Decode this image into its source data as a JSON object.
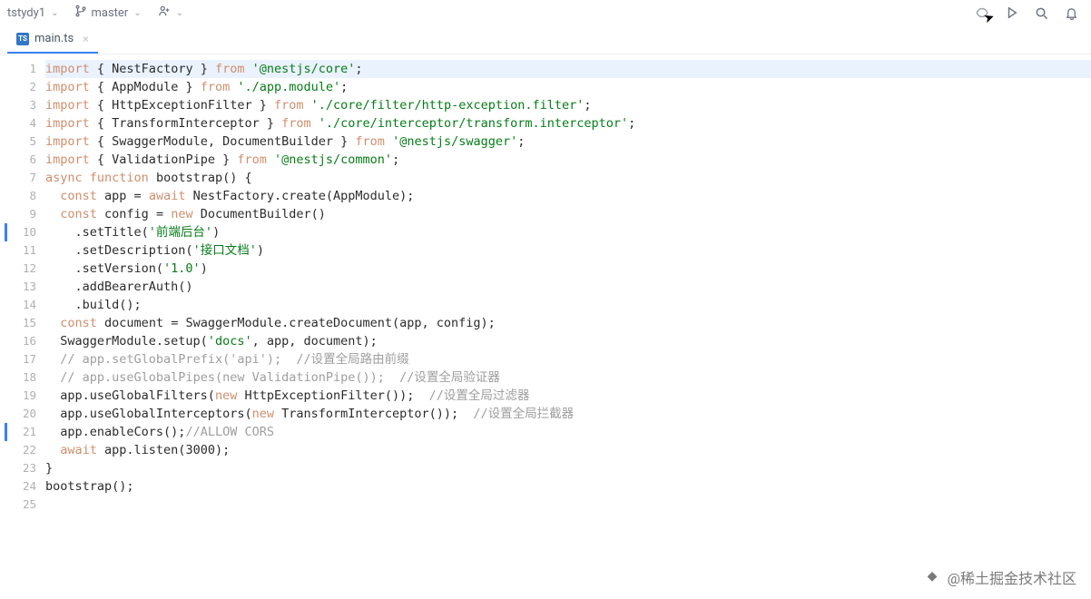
{
  "toolbar": {
    "project": "tstydy1",
    "branch": "master"
  },
  "tab": {
    "filename": "main.ts",
    "file_badge": "TS"
  },
  "code": {
    "lines": [
      {
        "n": 1,
        "hl": true,
        "tokens": [
          {
            "c": "kw-import",
            "t": "import"
          },
          {
            "c": "punct",
            "t": " { "
          },
          {
            "c": "ident",
            "t": "NestFactory"
          },
          {
            "c": "punct",
            "t": " } "
          },
          {
            "c": "kw-from",
            "t": "from"
          },
          {
            "c": "punct",
            "t": " "
          },
          {
            "c": "str",
            "t": "'@nestjs/core'"
          },
          {
            "c": "punct",
            "t": ";"
          }
        ]
      },
      {
        "n": 2,
        "tokens": [
          {
            "c": "kw-import",
            "t": "import"
          },
          {
            "c": "punct",
            "t": " { "
          },
          {
            "c": "ident",
            "t": "AppModule"
          },
          {
            "c": "punct",
            "t": " } "
          },
          {
            "c": "kw-from",
            "t": "from"
          },
          {
            "c": "punct",
            "t": " "
          },
          {
            "c": "str",
            "t": "'./app.module'"
          },
          {
            "c": "punct",
            "t": ";"
          }
        ]
      },
      {
        "n": 3,
        "tokens": [
          {
            "c": "kw-import",
            "t": "import"
          },
          {
            "c": "punct",
            "t": " { "
          },
          {
            "c": "ident",
            "t": "HttpExceptionFilter"
          },
          {
            "c": "punct",
            "t": " } "
          },
          {
            "c": "kw-from",
            "t": "from"
          },
          {
            "c": "punct",
            "t": " "
          },
          {
            "c": "str",
            "t": "'./core/filter/http-exception.filter'"
          },
          {
            "c": "punct",
            "t": ";"
          }
        ]
      },
      {
        "n": 4,
        "tokens": [
          {
            "c": "kw-import",
            "t": "import"
          },
          {
            "c": "punct",
            "t": " { "
          },
          {
            "c": "ident",
            "t": "TransformInterceptor"
          },
          {
            "c": "punct",
            "t": " } "
          },
          {
            "c": "kw-from",
            "t": "from"
          },
          {
            "c": "punct",
            "t": " "
          },
          {
            "c": "str",
            "t": "'./core/interceptor/transform.interceptor'"
          },
          {
            "c": "punct",
            "t": ";"
          }
        ]
      },
      {
        "n": 5,
        "tokens": [
          {
            "c": "kw-import",
            "t": "import"
          },
          {
            "c": "punct",
            "t": " { "
          },
          {
            "c": "ident",
            "t": "SwaggerModule, DocumentBuilder"
          },
          {
            "c": "punct",
            "t": " } "
          },
          {
            "c": "kw-from",
            "t": "from"
          },
          {
            "c": "punct",
            "t": " "
          },
          {
            "c": "str",
            "t": "'@nestjs/swagger'"
          },
          {
            "c": "punct",
            "t": ";"
          }
        ]
      },
      {
        "n": 6,
        "tokens": [
          {
            "c": "kw-import",
            "t": "import"
          },
          {
            "c": "punct",
            "t": " { "
          },
          {
            "c": "ident",
            "t": "ValidationPipe"
          },
          {
            "c": "punct",
            "t": " } "
          },
          {
            "c": "kw-from",
            "t": "from"
          },
          {
            "c": "punct",
            "t": " "
          },
          {
            "c": "str",
            "t": "'@nestjs/common'"
          },
          {
            "c": "punct",
            "t": ";"
          }
        ]
      },
      {
        "n": 7,
        "tokens": [
          {
            "c": "kw-async",
            "t": "async"
          },
          {
            "c": "punct",
            "t": " "
          },
          {
            "c": "kw-func",
            "t": "function"
          },
          {
            "c": "punct",
            "t": " "
          },
          {
            "c": "ident",
            "t": "bootstrap() {"
          }
        ]
      },
      {
        "n": 8,
        "tokens": [
          {
            "c": "punct",
            "t": "  "
          },
          {
            "c": "kw-const",
            "t": "const"
          },
          {
            "c": "punct",
            "t": " "
          },
          {
            "c": "ident",
            "t": "app = "
          },
          {
            "c": "kw-await",
            "t": "await"
          },
          {
            "c": "punct",
            "t": " "
          },
          {
            "c": "ident",
            "t": "NestFactory.create(AppModule);"
          }
        ]
      },
      {
        "n": 9,
        "tokens": [
          {
            "c": "punct",
            "t": "  "
          },
          {
            "c": "kw-const",
            "t": "const"
          },
          {
            "c": "punct",
            "t": " "
          },
          {
            "c": "ident",
            "t": "config = "
          },
          {
            "c": "kw-new",
            "t": "new"
          },
          {
            "c": "punct",
            "t": " "
          },
          {
            "c": "ident",
            "t": "DocumentBuilder()"
          }
        ]
      },
      {
        "n": 10,
        "bar": true,
        "tokens": [
          {
            "c": "ident",
            "t": "    .setTitle("
          },
          {
            "c": "str",
            "t": "'前端后台'"
          },
          {
            "c": "ident",
            "t": ")"
          }
        ]
      },
      {
        "n": 11,
        "tokens": [
          {
            "c": "ident",
            "t": "    .setDescription("
          },
          {
            "c": "str",
            "t": "'接口文档'"
          },
          {
            "c": "ident",
            "t": ")"
          }
        ]
      },
      {
        "n": 12,
        "tokens": [
          {
            "c": "ident",
            "t": "    .setVersion("
          },
          {
            "c": "str",
            "t": "'1.0'"
          },
          {
            "c": "ident",
            "t": ")"
          }
        ]
      },
      {
        "n": 13,
        "tokens": [
          {
            "c": "ident",
            "t": "    .addBearerAuth()"
          }
        ]
      },
      {
        "n": 14,
        "tokens": [
          {
            "c": "ident",
            "t": "    .build();"
          }
        ]
      },
      {
        "n": 15,
        "tokens": [
          {
            "c": "punct",
            "t": "  "
          },
          {
            "c": "kw-const",
            "t": "const"
          },
          {
            "c": "punct",
            "t": " "
          },
          {
            "c": "ident",
            "t": "document = SwaggerModule.createDocument(app, config);"
          }
        ]
      },
      {
        "n": 16,
        "tokens": [
          {
            "c": "ident",
            "t": "  SwaggerModule.setup("
          },
          {
            "c": "str",
            "t": "'docs'"
          },
          {
            "c": "ident",
            "t": ", app, document);"
          }
        ]
      },
      {
        "n": 17,
        "tokens": [
          {
            "c": "punct",
            "t": "  "
          },
          {
            "c": "cmt",
            "t": "// app.setGlobalPrefix('api');  //"
          },
          {
            "c": "cmt-cn",
            "t": "设置全局路由前缀"
          }
        ]
      },
      {
        "n": 18,
        "tokens": [
          {
            "c": "punct",
            "t": "  "
          },
          {
            "c": "cmt",
            "t": "// app.useGlobalPipes(new ValidationPipe());  //"
          },
          {
            "c": "cmt-cn",
            "t": "设置全局验证器"
          }
        ]
      },
      {
        "n": 19,
        "tokens": [
          {
            "c": "ident",
            "t": "  app.useGlobalFilters("
          },
          {
            "c": "kw-new",
            "t": "new"
          },
          {
            "c": "ident",
            "t": " HttpExceptionFilter());  "
          },
          {
            "c": "cmt",
            "t": "//"
          },
          {
            "c": "cmt-cn",
            "t": "设置全局过滤器"
          }
        ]
      },
      {
        "n": 20,
        "tokens": [
          {
            "c": "ident",
            "t": "  app.useGlobalInterceptors("
          },
          {
            "c": "kw-new",
            "t": "new"
          },
          {
            "c": "ident",
            "t": " TransformInterceptor());  "
          },
          {
            "c": "cmt",
            "t": "//"
          },
          {
            "c": "cmt-cn",
            "t": "设置全局拦截器"
          }
        ]
      },
      {
        "n": 21,
        "bar": true,
        "tokens": [
          {
            "c": "ident",
            "t": "  app.enableCors();"
          },
          {
            "c": "cmt",
            "t": "//ALLOW CORS"
          }
        ]
      },
      {
        "n": 22,
        "tokens": [
          {
            "c": "punct",
            "t": "  "
          },
          {
            "c": "kw-await",
            "t": "await"
          },
          {
            "c": "ident",
            "t": " app.listen(3000);"
          }
        ]
      },
      {
        "n": 23,
        "tokens": [
          {
            "c": "ident",
            "t": "}"
          }
        ]
      },
      {
        "n": 24,
        "tokens": [
          {
            "c": "ident",
            "t": "bootstrap();"
          }
        ]
      },
      {
        "n": 25,
        "tokens": []
      }
    ]
  },
  "watermark": "@稀土掘金技术社区"
}
